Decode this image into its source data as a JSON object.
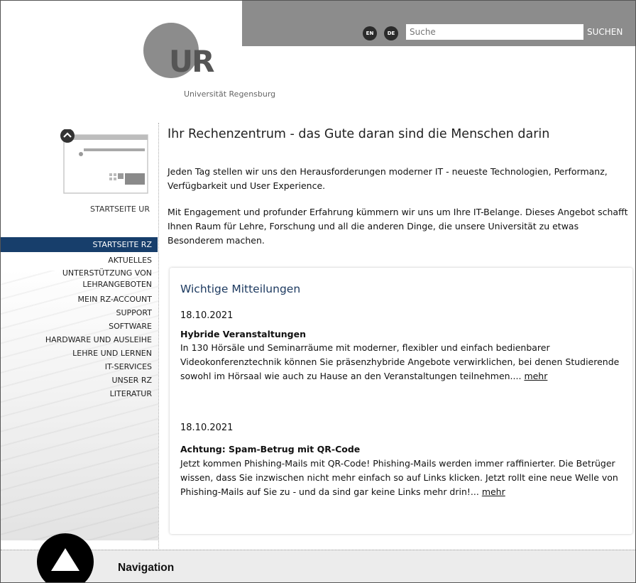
{
  "header": {
    "lang_en": "EN",
    "lang_de": "DE",
    "search_placeholder": "Suche",
    "search_button": "SUCHEN"
  },
  "logo": {
    "mark": "UR",
    "name": "Universität Regensburg"
  },
  "sidebar": {
    "home_link": "STARTSEITE UR",
    "items": [
      {
        "label": "STARTSEITE RZ",
        "active": true
      },
      {
        "label": "AKTUELLES"
      },
      {
        "label": "UNTERSTÜTZUNG VON LEHRANGEBOTEN"
      },
      {
        "label": "MEIN RZ-ACCOUNT"
      },
      {
        "label": "SUPPORT"
      },
      {
        "label": "SOFTWARE"
      },
      {
        "label": "HARDWARE UND AUSLEIHE"
      },
      {
        "label": "LEHRE UND LERNEN"
      },
      {
        "label": "IT-SERVICES"
      },
      {
        "label": "UNSER RZ"
      },
      {
        "label": "LITERATUR"
      }
    ]
  },
  "main": {
    "headline": "Ihr Rechenzentrum - das Gute daran sind die Menschen darin",
    "intro_1": "Jeden Tag stellen wir uns den Herausforderungen moderner IT - neueste Technologien, Performanz, Verfügbarkeit und User Experience.",
    "intro_2": "Mit Engagement und profunder Erfahrung kümmern wir uns um Ihre IT-Belange. Dieses Angebot schafft Ihnen Raum für Lehre, Forschung und all die anderen Dinge, die unsere Universität zu etwas Besonderem machen.",
    "notices": {
      "title": "Wichtige Mitteilungen",
      "items": [
        {
          "date": "18.10.2021",
          "title": "Hybride Veranstaltungen",
          "text": "In 130 Hörsäle und Seminarräume mit moderner, flexibler und einfach bedienbarer Videokonferenztechnik können Sie präsenzhybride Angebote verwirklichen, bei denen Studierende sowohl im Hörsaal wie auch zu Hause an den Veranstaltungen teilnehmen....",
          "more": "mehr"
        },
        {
          "date": "18.10.2021",
          "title": "Achtung: Spam-Betrug mit QR-Code",
          "text": "Jetzt kommen Phishing-Mails mit QR-Code! Phishing-Mails werden immer raffinierter. Die Betrüger wissen, dass Sie inzwischen nicht mehr einfach so auf Links klicken. Jetzt rollt eine neue Welle von Phishing-Mails auf Sie zu - und da sind gar keine Links mehr drin!...",
          "more": "mehr"
        }
      ]
    }
  },
  "footer": {
    "nav_label": "Navigation"
  }
}
